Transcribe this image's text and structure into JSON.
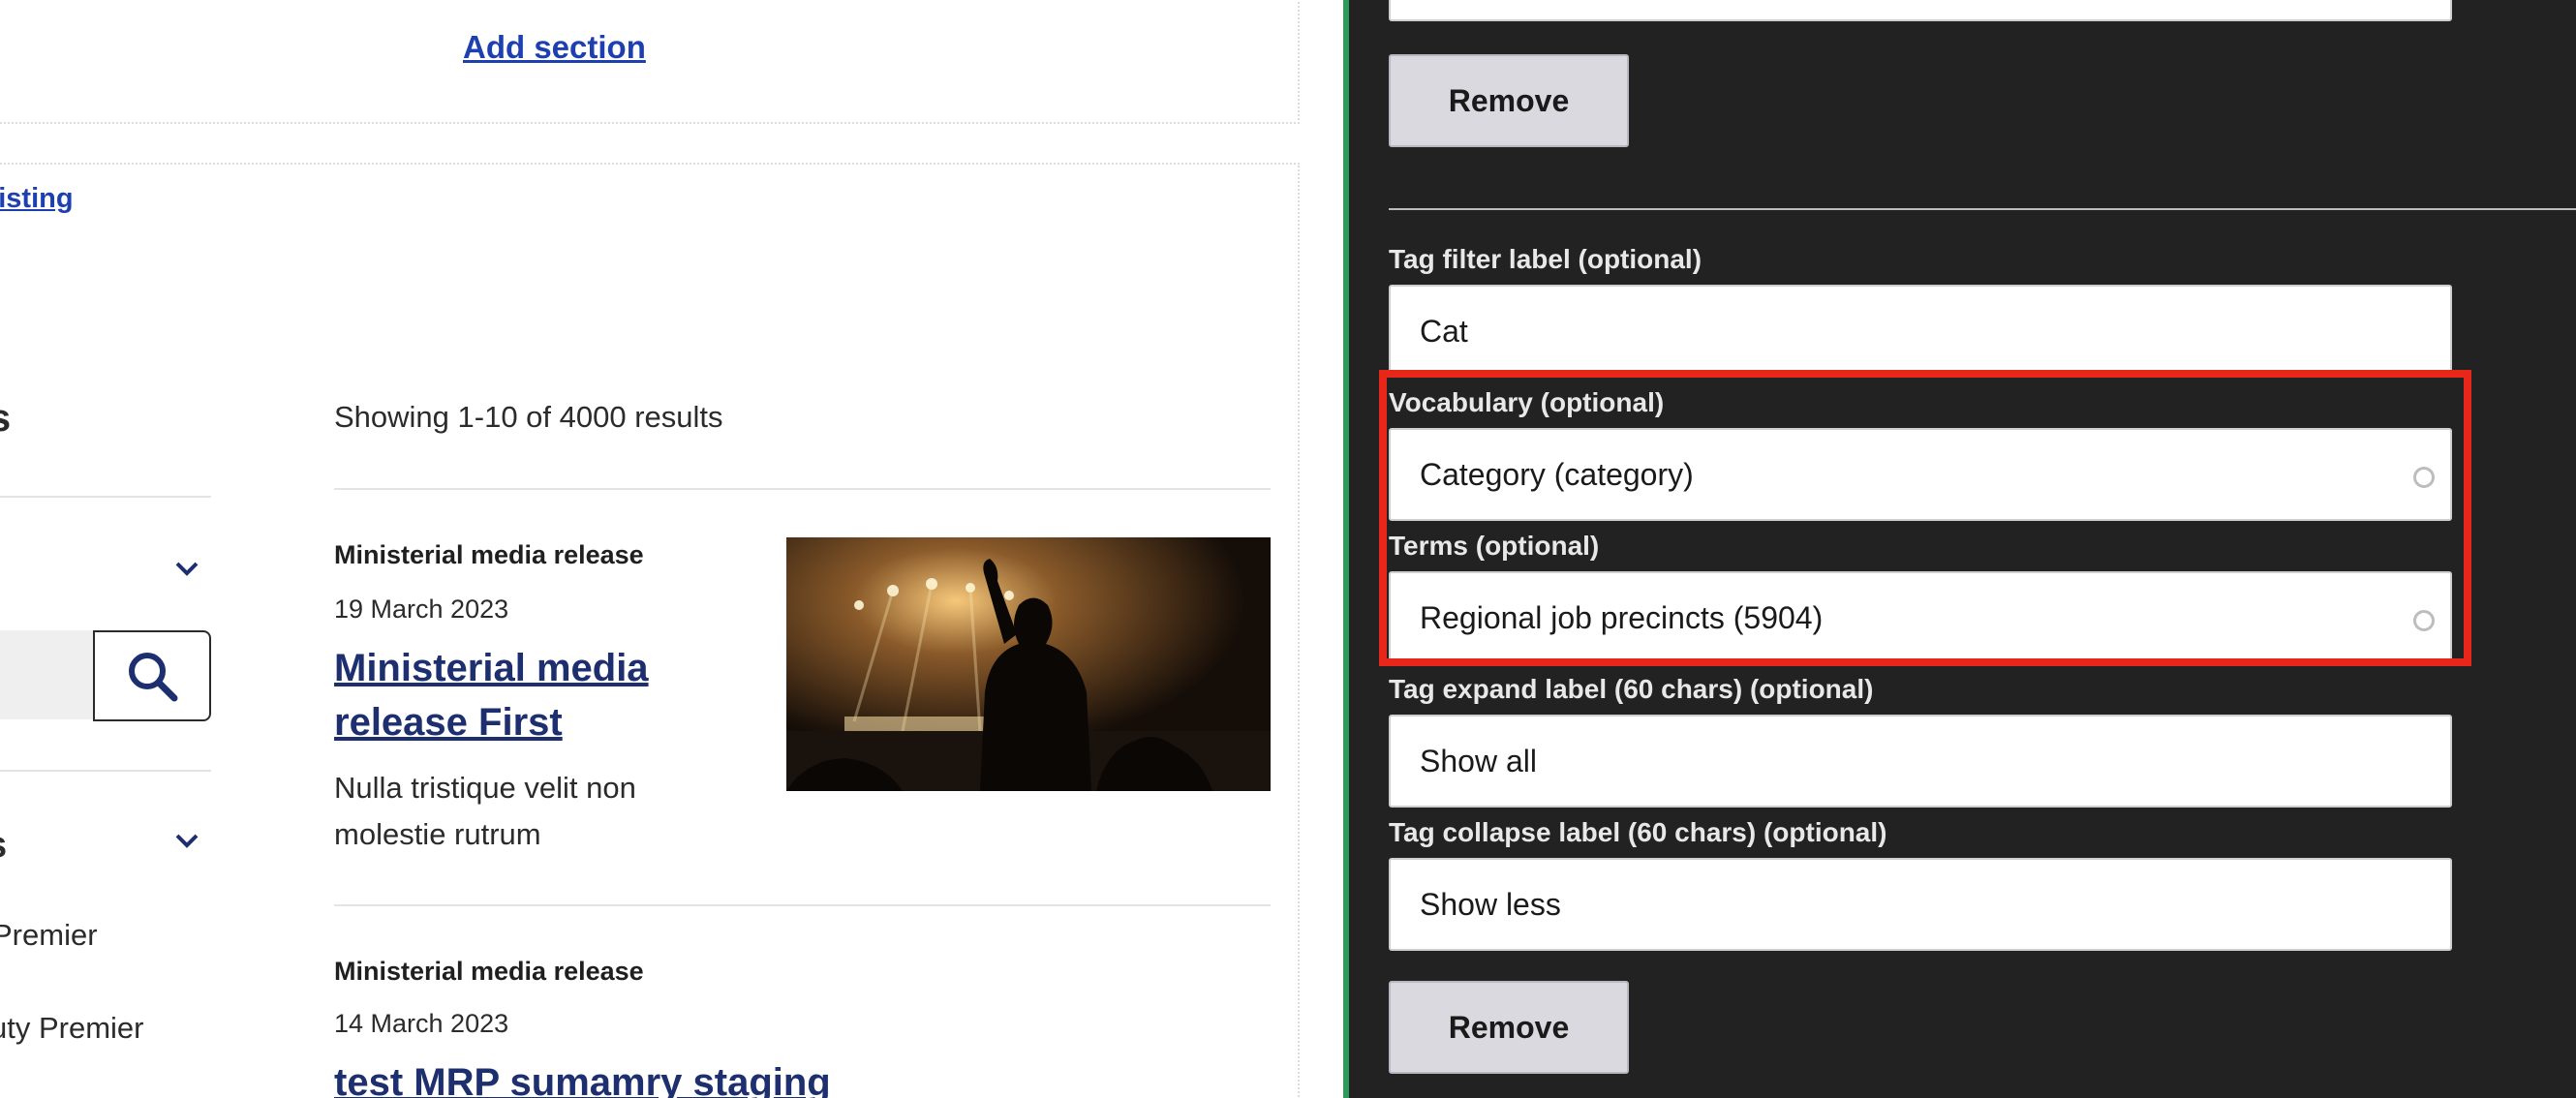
{
  "preview": {
    "add_section": "Add section",
    "listing_link": "e listing",
    "results_heading": "ults",
    "filter_heading": "s",
    "filter_options": [
      "Premier",
      "uty Premier"
    ],
    "showing": "Showing 1-10 of 4000 results",
    "cards": [
      {
        "type": "Ministerial media release",
        "date": "19 March 2023",
        "title_lines": [
          "Ministerial media",
          "release First"
        ],
        "desc_lines": [
          "Nulla tristique velit non",
          "molestie rutrum"
        ]
      },
      {
        "type": "Ministerial media release",
        "date": "14 March 2023",
        "title_lines": [
          "test MRP sumamry staging"
        ]
      }
    ]
  },
  "panel": {
    "top_input_value": "",
    "remove_label": "Remove",
    "fields": {
      "tag_filter_label": {
        "label": "Tag filter label (optional)",
        "value": "Cat"
      },
      "vocabulary": {
        "label": "Vocabulary (optional)",
        "value": "Category (category)"
      },
      "terms": {
        "label": "Terms (optional)",
        "value": "Regional job precincts (5904)"
      },
      "tag_expand": {
        "label": "Tag expand label (60 chars) (optional)",
        "value": "Show all"
      },
      "tag_collapse": {
        "label": "Tag collapse label (60 chars) (optional)",
        "value": "Show less"
      }
    }
  },
  "colors": {
    "panel_bg": "#222222",
    "panel_edge": "#2e9a5a",
    "link_blue": "#1d3fb0",
    "title_navy": "#1d2f6e",
    "highlight_red": "#e8261a"
  }
}
